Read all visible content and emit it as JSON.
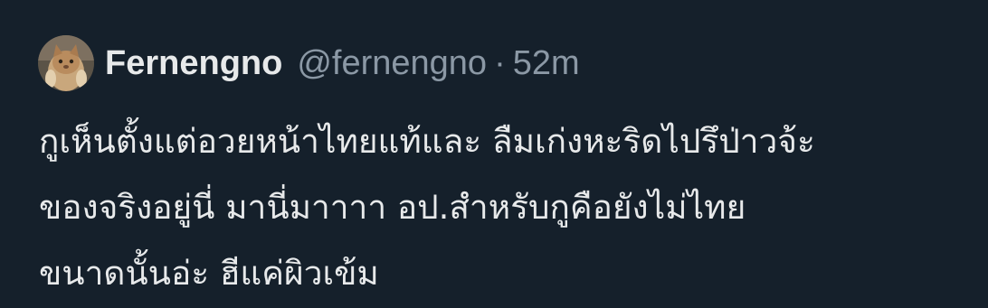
{
  "tweet": {
    "author": {
      "display_name": "Fernengno",
      "handle": "@fernengno",
      "avatar": "cat-avatar"
    },
    "separator": "·",
    "time": "52m",
    "text_lines": [
      "กูเห็นตั้งแต่อวยหน้าไทยแท้และ ลืมเก่งหะริดไปรึป่าวจ้ะ",
      "ของจริงอยู่นี่ มานี่มาาาา อป.สำหรับกูคือยังไม่ไทย",
      "ขนาดนั้นอ่ะ ฮีแค่ผิวเข้ม"
    ]
  },
  "colors": {
    "background": "#15202b",
    "primary_text": "#e7e9ea",
    "secondary_text": "#8b98a5"
  }
}
